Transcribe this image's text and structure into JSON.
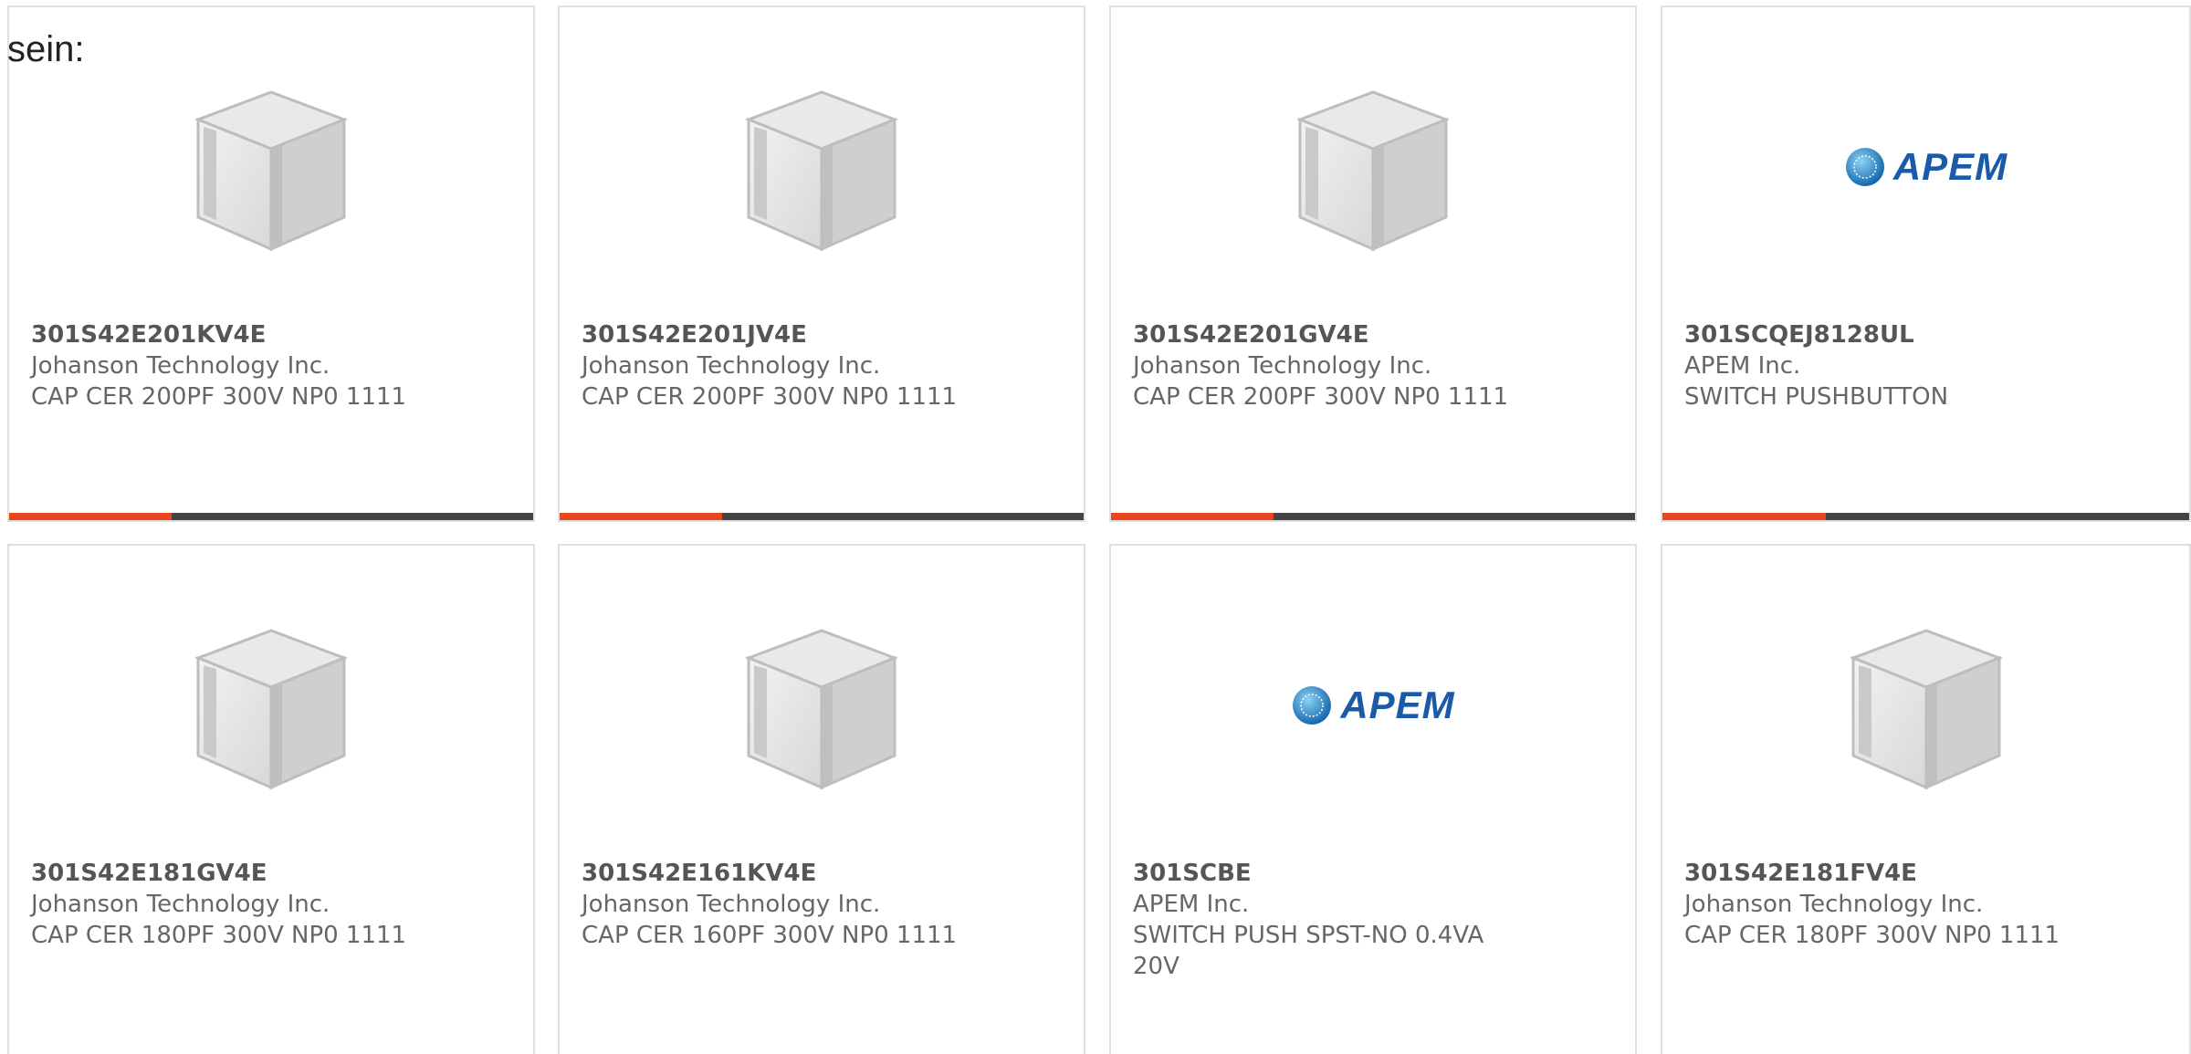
{
  "lead_text": "sein:",
  "colors": {
    "progress_fill": "#e8461b",
    "progress_track": "#444444",
    "apem_blue": "#1a5aa8"
  },
  "products": [
    {
      "part_number": "301S42E201KV4E",
      "manufacturer": "Johanson Technology Inc.",
      "description": "CAP CER 200PF 300V NP0 1111",
      "image": "capacitor-cube",
      "progress": 0.31
    },
    {
      "part_number": "301S42E201JV4E",
      "manufacturer": "Johanson Technology Inc.",
      "description": "CAP CER 200PF 300V NP0 1111",
      "image": "capacitor-cube",
      "progress": 0.31
    },
    {
      "part_number": "301S42E201GV4E",
      "manufacturer": "Johanson Technology Inc.",
      "description": "CAP CER 200PF 300V NP0 1111",
      "image": "capacitor-cube",
      "progress": 0.31
    },
    {
      "part_number": "301SCQEJ8128UL",
      "manufacturer": "APEM Inc.",
      "description": "SWITCH PUSHBUTTON",
      "image": "apem-logo",
      "logo_text": "APEM",
      "progress": 0.31
    },
    {
      "part_number": "301S42E181GV4E",
      "manufacturer": "Johanson Technology Inc.",
      "description": "CAP CER 180PF 300V NP0 1111",
      "image": "capacitor-cube"
    },
    {
      "part_number": "301S42E161KV4E",
      "manufacturer": "Johanson Technology Inc.",
      "description": "CAP CER 160PF 300V NP0 1111",
      "image": "capacitor-cube"
    },
    {
      "part_number": "301SCBE",
      "manufacturer": "APEM Inc.",
      "description": "SWITCH PUSH SPST-NO 0.4VA 20V",
      "image": "apem-logo",
      "logo_text": "APEM"
    },
    {
      "part_number": "301S42E181FV4E",
      "manufacturer": "Johanson Technology Inc.",
      "description": "CAP CER 180PF 300V NP0 1111",
      "image": "capacitor-cube"
    }
  ]
}
